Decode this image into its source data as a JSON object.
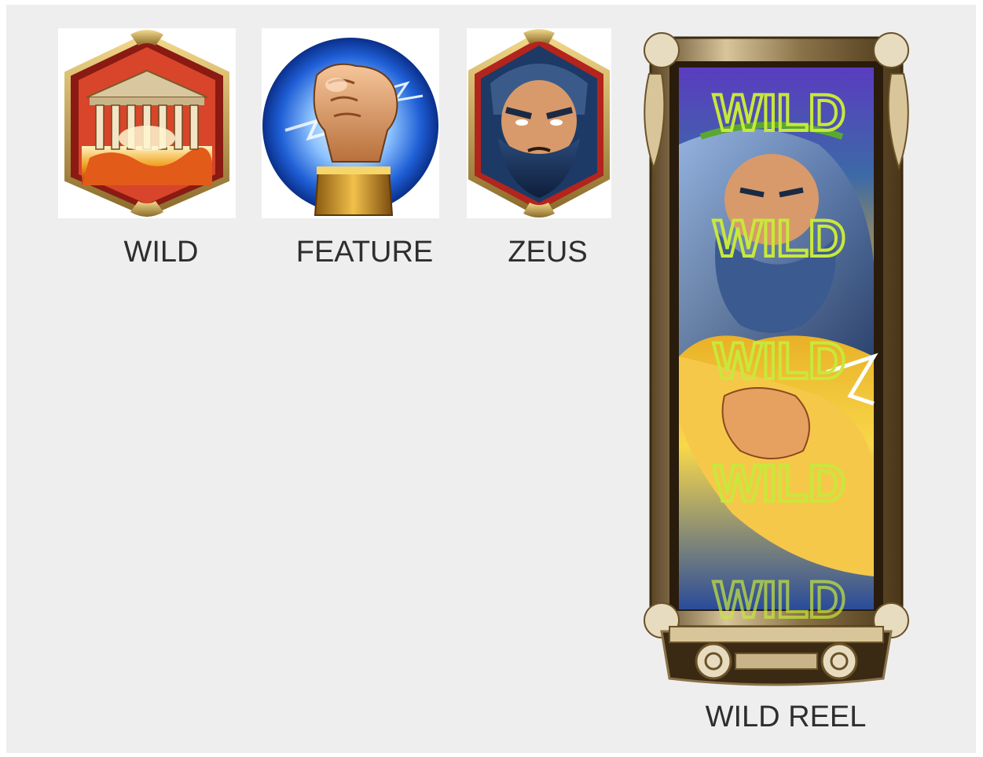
{
  "symbols": [
    {
      "id": "wild",
      "label": "WILD",
      "icon": "temple-icon"
    },
    {
      "id": "feature",
      "label": "FEATURE",
      "icon": "fist-lightning-icon"
    },
    {
      "id": "zeus",
      "label": "ZEUS",
      "icon": "zeus-face-icon"
    }
  ],
  "wild_reel": {
    "label": "WILD REEL",
    "icon": "zeus-wild-reel-icon",
    "overlay_texts": [
      "WILD",
      "WILD",
      "WILD",
      "WILD",
      "WILD"
    ]
  },
  "colors": {
    "background": "#eeeeee",
    "gold": "#c9a24a",
    "frame_red": "#b3241c",
    "lightning_blue": "#1f5fd6",
    "wild_text": "#c8e83a"
  }
}
